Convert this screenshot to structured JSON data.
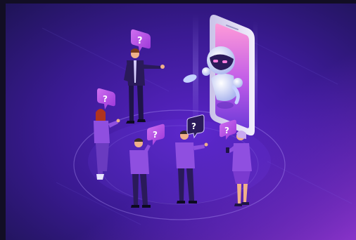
{
  "illustration": {
    "speech_bubble_glyph": "?",
    "colors": {
      "background_dark": "#2a1768",
      "background_mid": "#4a1fb0",
      "background_light": "#7a2ed8",
      "phone_frame": "#e9e6f5",
      "phone_screen_top": "#ff8fd9",
      "phone_screen_bottom": "#7b3be0",
      "robot_body": "#d9e3ff",
      "robot_visor": "#2b1a5a",
      "bubble": "#b44ae6",
      "person_suit": "#3a1f7a",
      "person_shirt": "#8f4fe0"
    },
    "icons": [
      "robot-icon",
      "question-bubble-icon",
      "smartphone-icon"
    ]
  }
}
